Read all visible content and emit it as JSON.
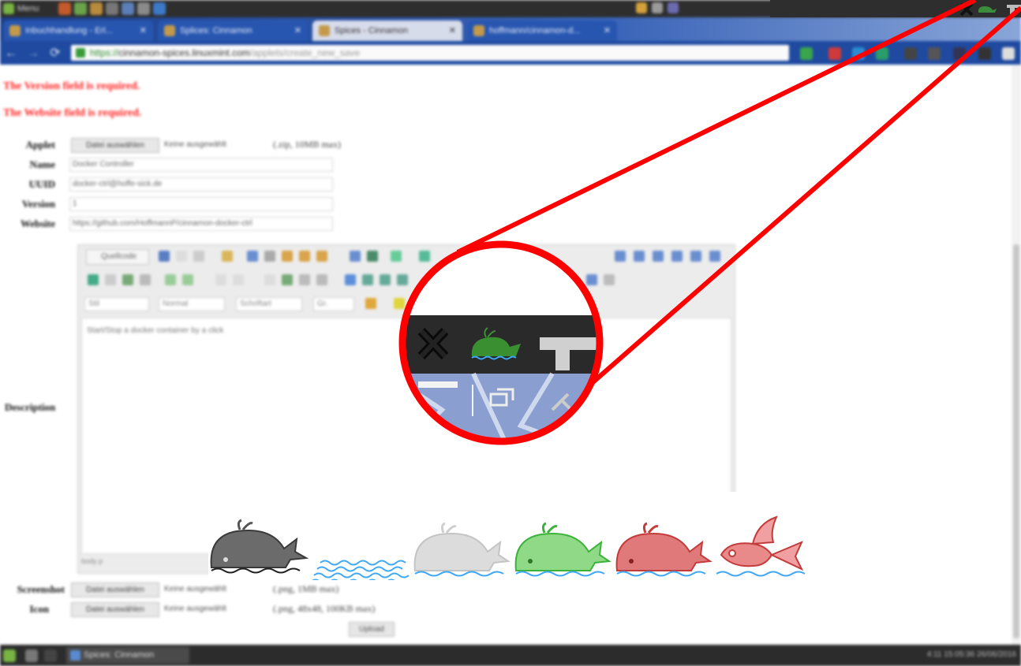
{
  "top_panel": {
    "menu_label": "Menu"
  },
  "tabs": [
    {
      "label": "Inbuchhandlung - Erl..."
    },
    {
      "label": "Splices: Cinnamon"
    },
    {
      "label": "Spices - Cinnamon"
    },
    {
      "label": "hoffmann/cinnamon-d..."
    }
  ],
  "address": {
    "protocol": "https://",
    "host": "cinnamon-spices.linuxmint.com",
    "path": "/applets/create_new_save"
  },
  "errors": [
    "The Version field is required.",
    "The Website field is required."
  ],
  "form": {
    "applet_label": "Applet",
    "file_button": "Datei auswählen",
    "no_file": "Keine ausgewählt",
    "applet_note": "(.zip, 10MB max)",
    "name_label": "Name",
    "name_value": "Docker Controller",
    "uuid_label": "UUID",
    "uuid_value": "docker-ctrl@hoffe-sick.de",
    "version_label": "Version",
    "version_value": "1",
    "website_label": "Website",
    "website_value": "https://github.com/HoffmannP/cinnamon-docker-ctrl",
    "description_label": "Description",
    "description_value": "Start/Stop a docker container by a click",
    "screenshot_label": "Screenshot",
    "screenshot_note": "(.png, 1MB max)",
    "icon_label": "Icon",
    "icon_note": "(.png, 48x48, 100KB max)",
    "submit_label": "Upload"
  },
  "editor": {
    "source_button": "Quellcode",
    "style_select": "Stil",
    "format_select": "Normal",
    "font_select": "Schriftart",
    "size_select": "Gr.",
    "footer": "body  p"
  },
  "taskbar": {
    "app_label": "Spices: Cinnamon",
    "clock": "4:11 15:05:36 26/06/2016"
  },
  "colors": {
    "callout": "#ff0000",
    "whale_gray": "#6b6b6b",
    "whale_light": "#d9d9d9",
    "whale_green": "#8fd987",
    "whale_red": "#e07a7a",
    "water_blue": "#3fa9f5"
  },
  "icons": [
    "close-x-icon",
    "docker-whale-icon",
    "network-tray-icon",
    "window-switch-icon"
  ]
}
